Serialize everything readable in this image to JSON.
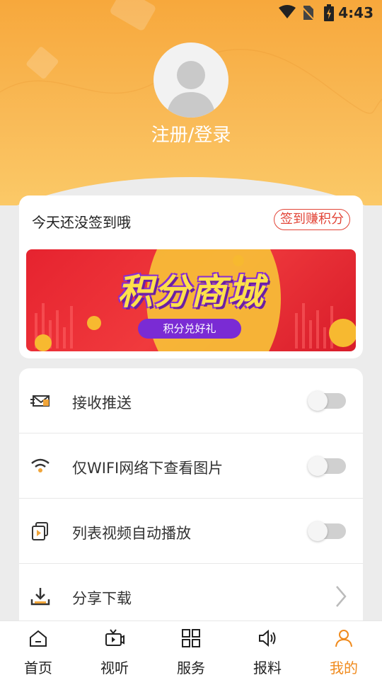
{
  "status_bar": {
    "time": "4:43"
  },
  "profile": {
    "login_label": "注册/登录"
  },
  "signin": {
    "prompt": "今天还没签到哦",
    "button": "签到赚积分",
    "banner_title": "积分商城",
    "banner_subtitle": "积分兑好礼"
  },
  "settings": [
    {
      "label": "接收推送",
      "icon": "envelope-icon",
      "control": "toggle",
      "on": false
    },
    {
      "label": "仅WIFI网络下查看图片",
      "icon": "wifi-icon",
      "control": "toggle",
      "on": false
    },
    {
      "label": "列表视频自动播放",
      "icon": "video-play-icon",
      "control": "toggle",
      "on": false
    },
    {
      "label": "分享下载",
      "icon": "download-icon",
      "control": "chevron"
    }
  ],
  "tabs": [
    {
      "label": "首页",
      "icon": "home-icon",
      "active": false
    },
    {
      "label": "视听",
      "icon": "tv-icon",
      "active": false
    },
    {
      "label": "服务",
      "icon": "grid-icon",
      "active": false
    },
    {
      "label": "报料",
      "icon": "speaker-icon",
      "active": false
    },
    {
      "label": "我的",
      "icon": "user-icon",
      "active": true
    }
  ],
  "colors": {
    "accent": "#f08a1c",
    "header": "#f7a83c",
    "signin_red": "#e24437"
  }
}
